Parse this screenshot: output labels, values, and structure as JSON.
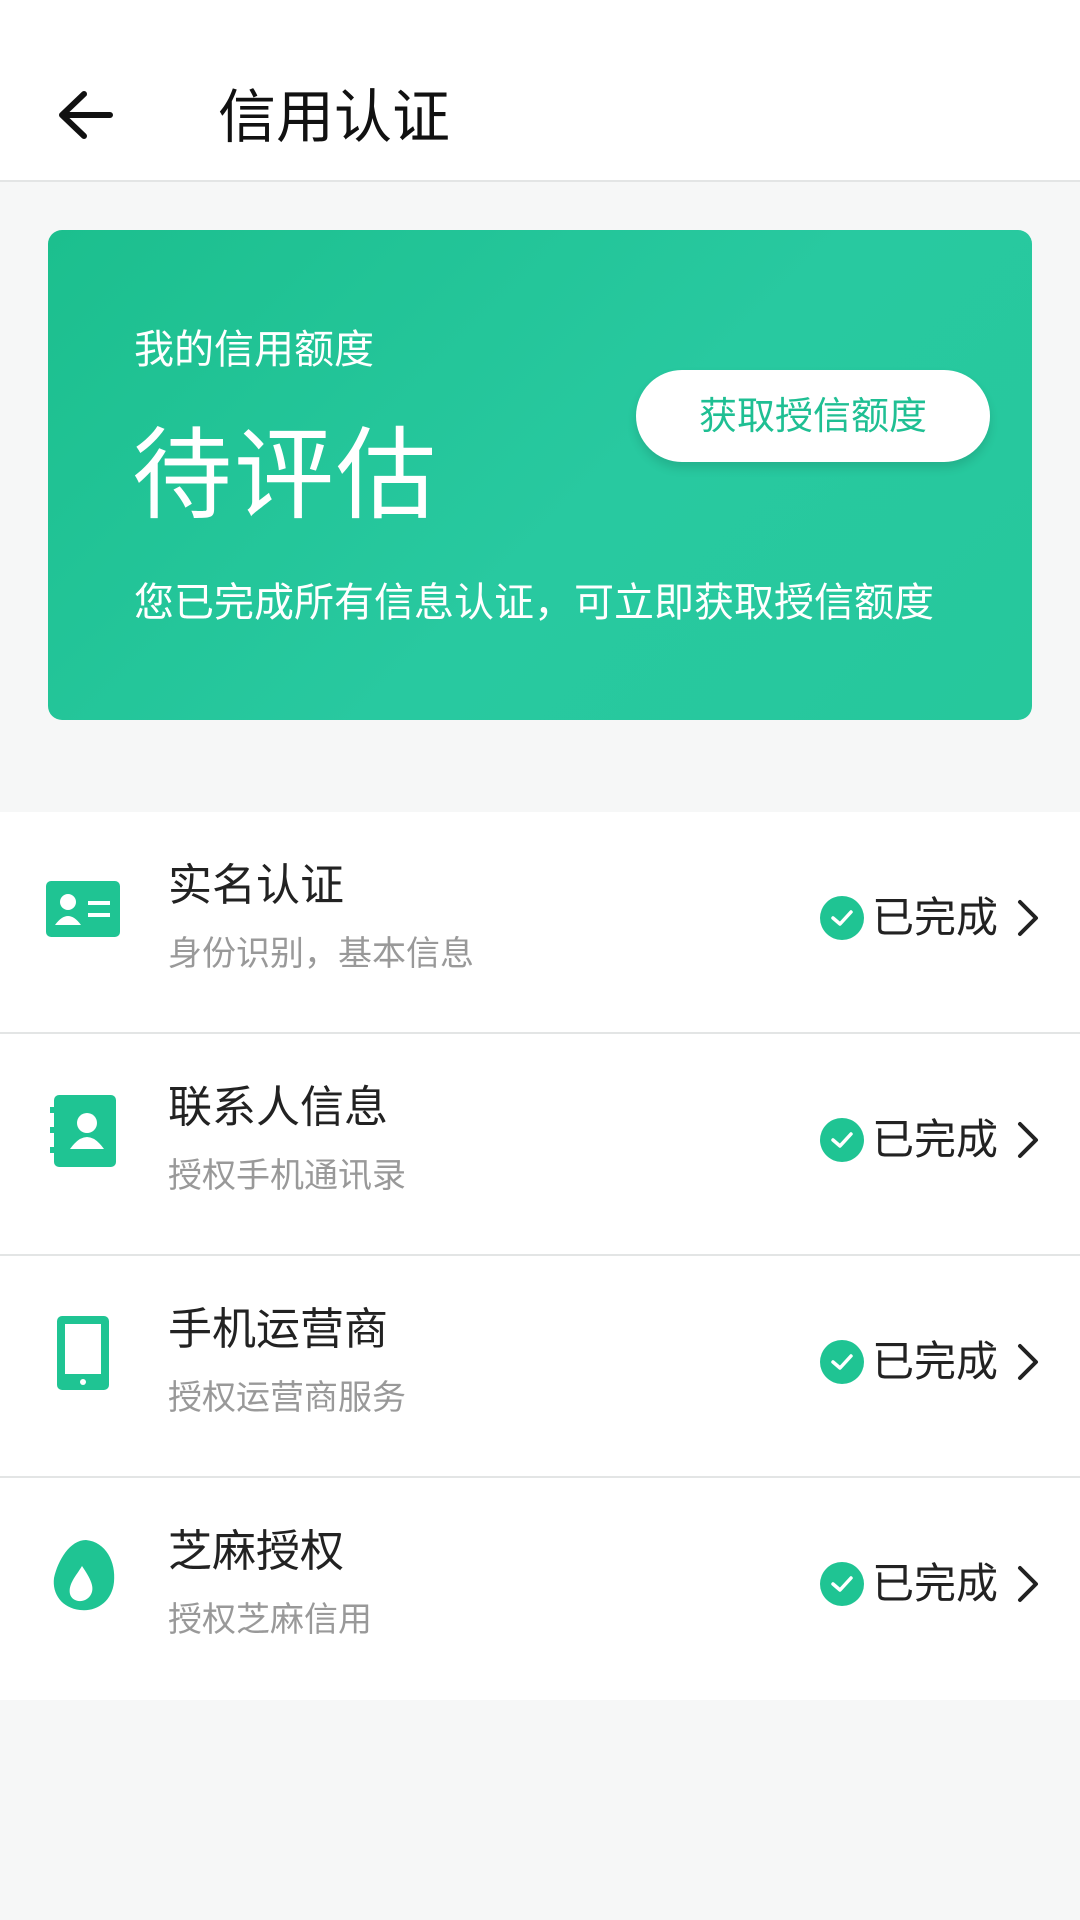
{
  "header": {
    "title": "信用认证",
    "back_icon": "arrow-left-icon"
  },
  "credit_card": {
    "label": "我的信用额度",
    "value": "待评估",
    "description": "您已完成所有信息认证，可立即获取授信额度",
    "button_label": "获取授信额度",
    "gradient_colors": [
      "#1cbf8e",
      "#28c9a0"
    ]
  },
  "verification_items": [
    {
      "title": "实名认证",
      "subtitle": "身份识别，基本信息",
      "status": "已完成",
      "icon": "id-card-icon"
    },
    {
      "title": "联系人信息",
      "subtitle": "授权手机通讯录",
      "status": "已完成",
      "icon": "contact-book-icon"
    },
    {
      "title": "手机运营商",
      "subtitle": "授权运营商服务",
      "status": "已完成",
      "icon": "mobile-phone-icon"
    },
    {
      "title": "芝麻授权",
      "subtitle": "授权芝麻信用",
      "status": "已完成",
      "icon": "sesame-icon"
    }
  ],
  "colors": {
    "accent": "#1fc493",
    "title_text": "#222222",
    "subtitle_text": "#999999"
  }
}
